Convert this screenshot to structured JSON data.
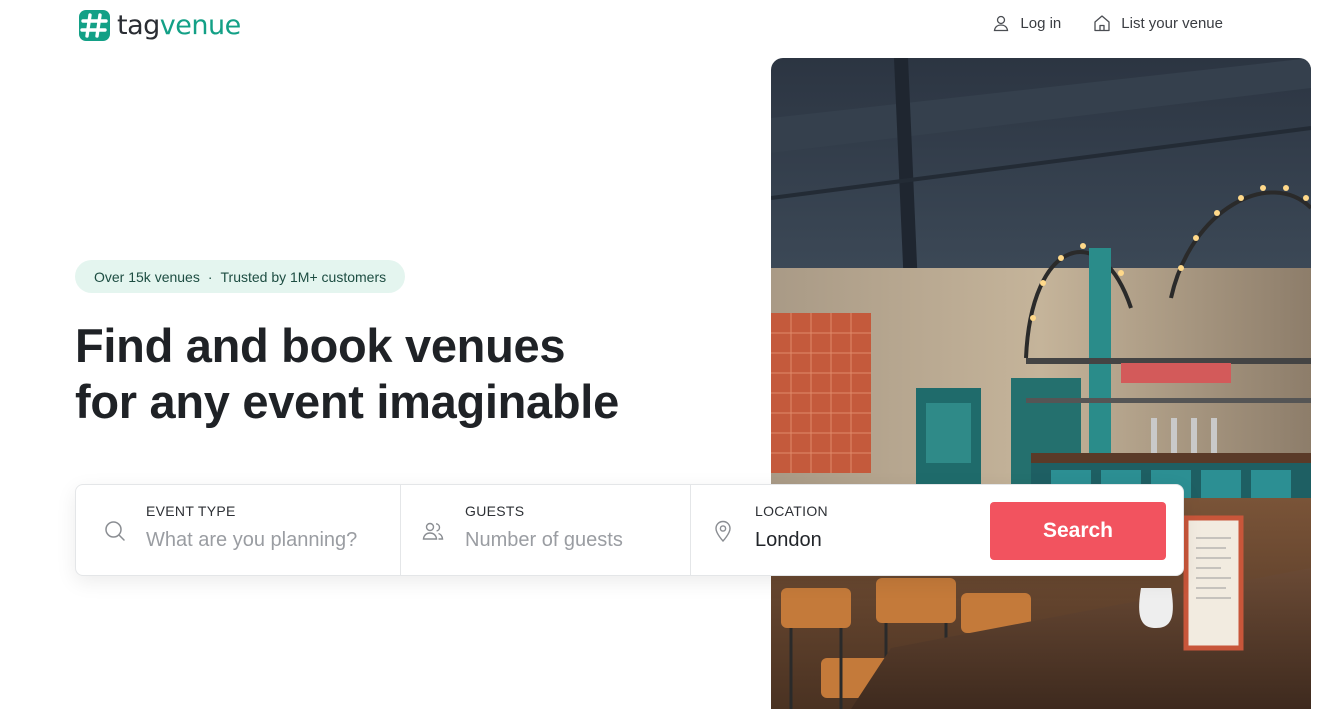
{
  "header": {
    "logo": {
      "text_tag": "tag",
      "text_venue": "venue",
      "icon": "tagvenue-hash-logo",
      "brand_color": "#13a086"
    },
    "nav": [
      {
        "label": "Log in",
        "icon": "user-icon"
      },
      {
        "label": "List your venue",
        "icon": "home-icon"
      }
    ]
  },
  "hero": {
    "badge": {
      "part1": "Over 15k venues",
      "separator": "·",
      "part2": "Trusted by 1M+ customers"
    },
    "headline": {
      "line1": "Find and book venues",
      "line2": "for any event imaginable"
    },
    "image": {
      "subject": "bar-restaurant-interior"
    }
  },
  "search": {
    "event_type": {
      "label": "EVENT TYPE",
      "placeholder": "What are you planning?",
      "icon": "search-icon"
    },
    "guests": {
      "label": "GUESTS",
      "placeholder": "Number of guests",
      "icon": "users-icon"
    },
    "location": {
      "label": "LOCATION",
      "value": "London",
      "icon": "map-pin-icon"
    },
    "button_label": "Search",
    "button_color": "#f2535f"
  }
}
